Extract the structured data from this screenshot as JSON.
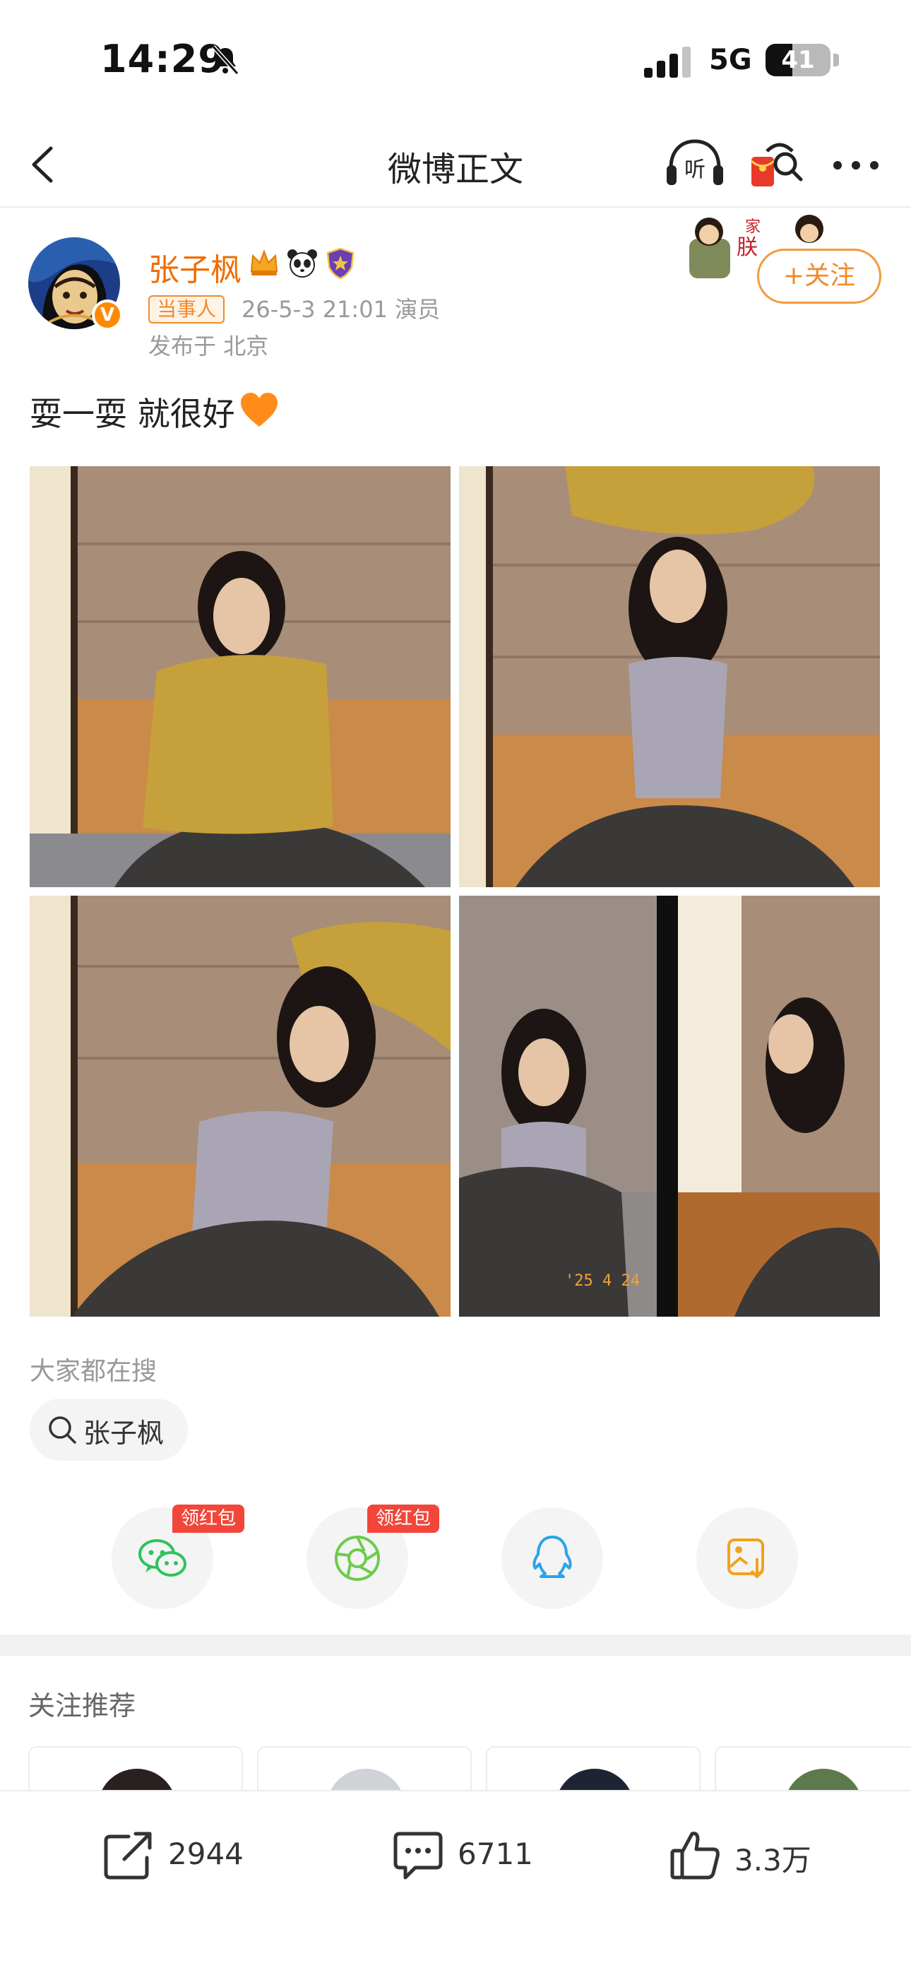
{
  "status_bar": {
    "time": "14:29",
    "network": "5G",
    "battery": "41",
    "battery_level": 0.41
  },
  "nav": {
    "title": "微博正文"
  },
  "post": {
    "author": {
      "name": "张子枫",
      "verified_badge": "V"
    },
    "tag": "当事人",
    "meta": "26-5-3 21:01  演员",
    "location": "发布于 北京",
    "follow_label": "+关注",
    "text": "耍一耍 就很好"
  },
  "search": {
    "heading": "大家都在搜",
    "query": "张子枫"
  },
  "share": {
    "items": [
      {
        "name": "wechat",
        "tag": "领红包"
      },
      {
        "name": "moments",
        "tag": "领红包"
      },
      {
        "name": "qq",
        "tag": ""
      },
      {
        "name": "save-image",
        "tag": ""
      }
    ]
  },
  "recommend": {
    "heading": "关注推荐"
  },
  "toolbar": {
    "reposts": "2944",
    "comments": "6711",
    "likes": "3.3万"
  },
  "colors": {
    "accent_orange": "#f08a2c",
    "name_orange": "#f06d00",
    "redpack_red": "#f2463a",
    "wechat_green": "#2dc35c",
    "qq_blue": "#2aa4e8"
  }
}
